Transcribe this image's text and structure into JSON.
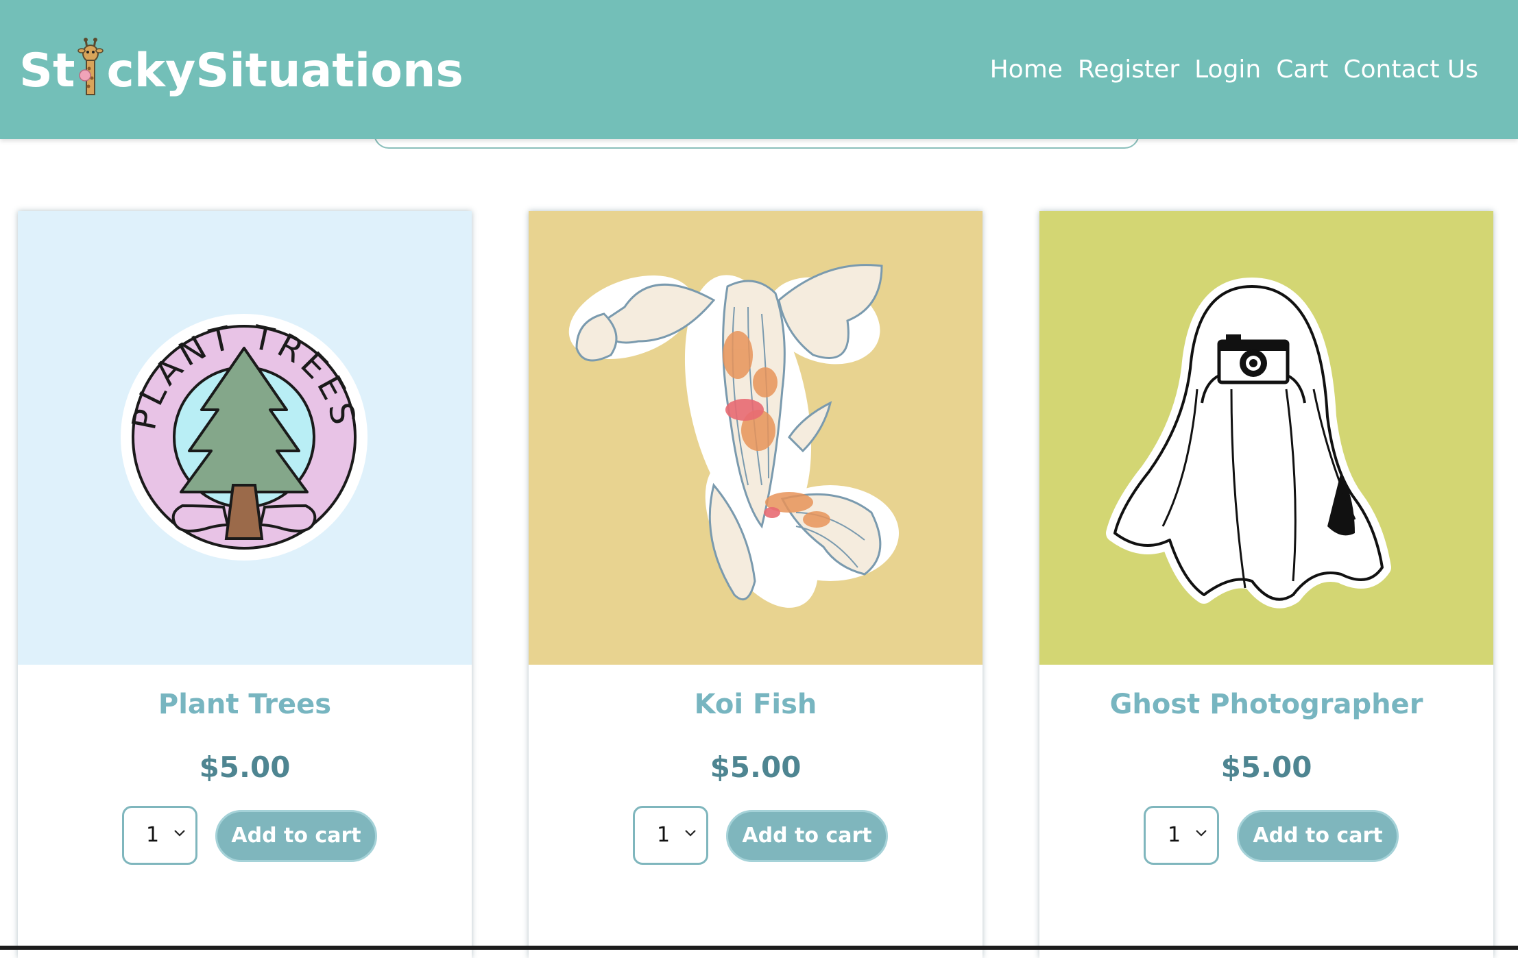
{
  "header": {
    "logo_part1": "St",
    "logo_part2": "ckySituations",
    "background_color": "#73bfb8",
    "nav": [
      {
        "label": "Home"
      },
      {
        "label": "Register"
      },
      {
        "label": "Login"
      },
      {
        "label": "Cart"
      },
      {
        "label": "Contact Us"
      }
    ]
  },
  "products": [
    {
      "name": "Plant Trees",
      "price": "$5.00",
      "quantity": "1",
      "add_label": "Add to cart",
      "image_bg": "#dff1fb",
      "image": "plant-trees-sticker"
    },
    {
      "name": "Koi Fish",
      "price": "$5.00",
      "quantity": "1",
      "add_label": "Add to cart",
      "image_bg": "#e8d390",
      "image": "koi-fish-sticker"
    },
    {
      "name": "Ghost Photographer",
      "price": "$5.00",
      "quantity": "1",
      "add_label": "Add to cart",
      "image_bg": "#d3d673",
      "image": "ghost-photographer-sticker"
    }
  ],
  "sticker_text": {
    "plant_trees": "PLANT TREES"
  }
}
